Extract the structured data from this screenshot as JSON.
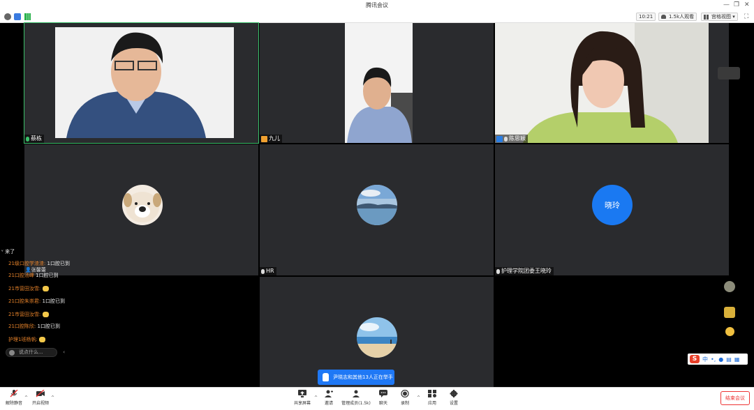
{
  "window": {
    "title": "腾讯会议"
  },
  "topbar": {
    "time": "10:21",
    "participants": "1.5k人观看",
    "view_mode": "宫格视图"
  },
  "tiles": [
    {
      "name": "蔡栋",
      "type": "video"
    },
    {
      "name": "九儿",
      "type": "video"
    },
    {
      "name": "陈思颖",
      "type": "video"
    },
    {
      "name": "",
      "type": "avatar-dog"
    },
    {
      "name": "HR",
      "type": "avatar-lake"
    },
    {
      "name": "护理学院团委王晓玲",
      "type": "avatar-letter",
      "avatar_text": "晓玲"
    },
    {
      "name": "",
      "type": "avatar-beach"
    }
  ],
  "chat": {
    "partial_top": "来了",
    "rows": [
      {
        "who": "21级口腔学渣渣:",
        "msg": "1口腔已到"
      },
      {
        "who": "21口腔汤峰",
        "msg": "1口腔已到"
      },
      {
        "who": "21市营田汝雪:",
        "msg": ""
      },
      {
        "who": "21口腔朱崇君:",
        "msg": "1口腔已到"
      },
      {
        "who": "21市营田汝雪:",
        "msg": ""
      },
      {
        "who": "21口腔陈欣:",
        "msg": "1口腔已到"
      },
      {
        "who": "护理1班杨帆:",
        "msg": ""
      }
    ],
    "overlap_name": "张馨蕾",
    "input_placeholder": "说点什么..."
  },
  "hand_toast": "尹晓志和其他13人正在举手",
  "ime": {
    "label": "中"
  },
  "bottombar": {
    "mute": "解除静音",
    "video": "开启视频",
    "share": "共享屏幕",
    "invite": "邀请",
    "members": "管理成员(1.5k)",
    "chat": "聊天",
    "record": "录制",
    "apps": "应用",
    "settings": "设置",
    "end": "结束会议"
  },
  "colors": {
    "accent": "#1a79f2",
    "danger": "#e53935",
    "speaking": "#3ac06a"
  }
}
